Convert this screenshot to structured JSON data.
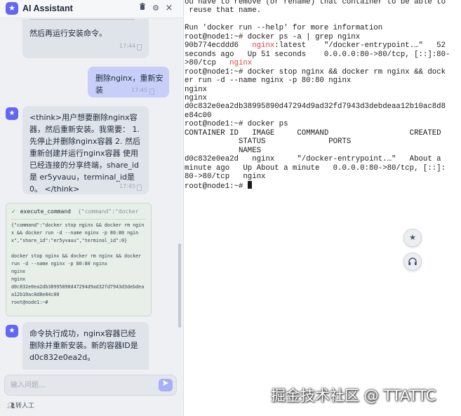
{
  "app": {
    "title": "AI Assistant",
    "logo_icon": "star-icon",
    "header_icons": [
      "trash-icon",
      "gear-icon",
      "close-icon"
    ]
  },
  "colors": {
    "accent": "#6366f1",
    "user_bubble": "#c7cff8",
    "prompt_red": "#e04040",
    "tool_card": "#e7efe8"
  },
  "chat": {
    "msg_partial": {
      "text": "然后再运行安装命令。",
      "time": "17:44"
    },
    "user_msg": {
      "text": "删除nginx，重新安装",
      "time": "17:45"
    },
    "think_msg": {
      "text": "<think>用户想要删除nginx容器，然后重新安装。我需要： 1. 先停止并删除nginx容器 2. 然后重新创建并运行nginx容器 使用已经连接的分享终端，share_id是 er5yvauu，terminal_id是0。 </think>",
      "time": "17:45"
    },
    "tool_call": {
      "name": "execute_command",
      "args_preview": "{\"command\":\"docker",
      "body_lines": [
        "{\"command\":\"docker stop nginx && docker rm ngin",
        "x && docker run -d --name nginx -p 80:80 ngin",
        "x\",\"share_id\":\"er5yvauu\",\"terminal_id\":0}",
        "",
        "docker stop nginx && docker rm nginx && docker",
        "run -d --name nginx -p 80:80 nginx",
        "nginx",
        "nginx",
        "d0c832e0ea2db38995890d47294d9ad32fd7943d3debdea",
        "a12b10ac8d8e84c00",
        "root@node1:~#"
      ]
    },
    "result_msg": {
      "text": "命令执行成功，nginx容器已经删除并重新安装。新的容器ID是 d0c832e0ea2d。"
    }
  },
  "input": {
    "placeholder": "输入问题...",
    "send_icon": "send-icon"
  },
  "handoff": {
    "label": "转人工",
    "icon": "people-icon"
  },
  "terminal": {
    "lines": [
      {
        "t": "ou have to remove (or rename) that container to be able to"
      },
      {
        "t": " reuse that name."
      },
      {
        "t": ""
      },
      {
        "t": "Run 'docker run --help' for more information"
      },
      {
        "t": "root@node1:~# docker ps -a | grep nginx"
      },
      {
        "pre": "90b774ecddd6   ",
        "red": "nginx",
        "post": ":latest    \"/docker-entrypoint.…\"   52"
      },
      {
        "t": "seconds ago   Up 51 seconds    0.0.0.0:80->80/tcp, [::]:80-"
      },
      {
        "pre": ">80/tcp   ",
        "red": "nginx",
        "post": ""
      },
      {
        "t": "root@node1:~# docker stop nginx && docker rm nginx && dock"
      },
      {
        "t": "er run -d --name nginx -p 80:80 nginx"
      },
      {
        "t": "nginx"
      },
      {
        "t": "nginx"
      },
      {
        "t": "d0c832e0ea2db38995890d47294d9ad32fd7943d3debdeaa12b10ac8d8"
      },
      {
        "t": "e84c00"
      },
      {
        "t": "root@node1:~# docker ps"
      },
      {
        "t": "CONTAINER ID   IMAGE     COMMAND                  CREATED"
      },
      {
        "t": "            STATUS              PORTS"
      },
      {
        "t": "            NAMES"
      },
      {
        "t": "d0c832e0ea2d   nginx     \"/docker-entrypoint.…\"   About a"
      },
      {
        "t": "minute ago   Up About a minute   0.0.0.0:80->80/tcp, [::]:"
      },
      {
        "t": "80->80/tcp   nginx"
      },
      {
        "t": "root@node1:~# ",
        "cursor": true
      }
    ]
  },
  "floating": {
    "assistant_icon": "star-icon",
    "support_icon": "headset-icon"
  },
  "watermark": "掘金技术社区 @ TTATTC"
}
